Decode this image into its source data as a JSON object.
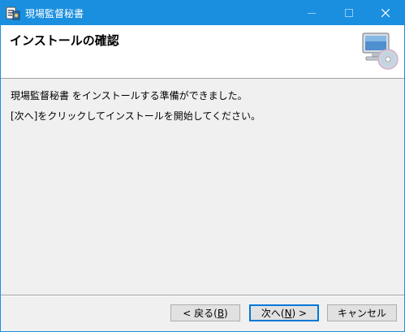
{
  "window": {
    "title": "現場監督秘書",
    "controls": {
      "minimize_icon": "minimize-icon",
      "maximize_icon": "maximize-icon",
      "close_icon": "close-icon"
    }
  },
  "banner": {
    "heading": "インストールの確認",
    "icon": "setup-computer-cd-icon"
  },
  "body": {
    "line1": "現場監督秘書 をインストールする準備ができました。",
    "line2": "[次へ]をクリックしてインストールを開始してください。"
  },
  "buttons": {
    "back": {
      "pre": "< 戻る(",
      "key": "B",
      "post": ")"
    },
    "next": {
      "pre": "次へ(",
      "key": "N",
      "post": ") >"
    },
    "cancel": "キャンセル"
  },
  "colors": {
    "titlebar": "#1a8fdf",
    "dialog_bg": "#f0f0f0",
    "default_button_border": "#0078d7"
  }
}
